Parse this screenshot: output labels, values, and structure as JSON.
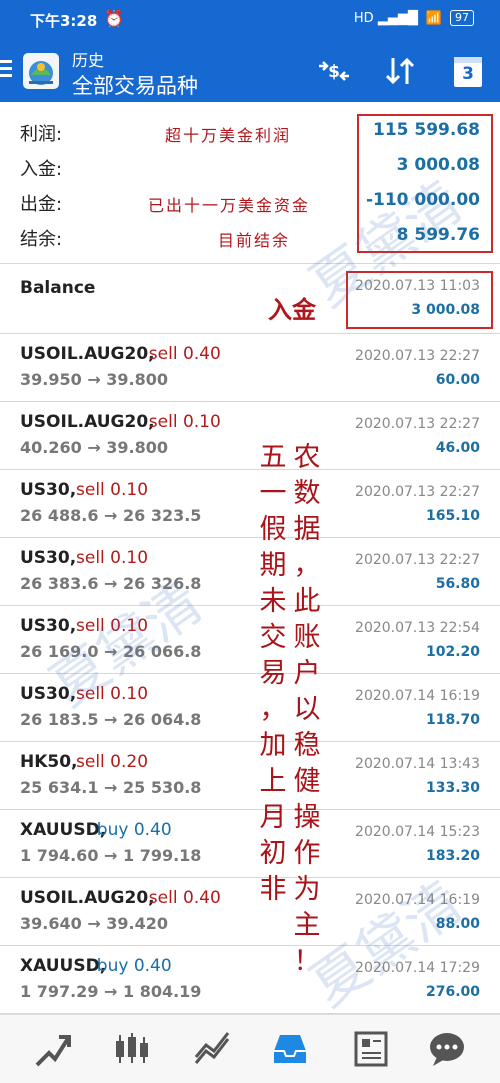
{
  "status_bar": {
    "time": "下午3:28",
    "signal": "HD",
    "battery": "97"
  },
  "app_bar": {
    "subtitle": "历史",
    "title": "全部交易品种",
    "calendar_day": "3",
    "icons": [
      "menu-icon",
      "app-logo",
      "currency-swap-icon",
      "sort-icon",
      "calendar-icon"
    ]
  },
  "summary": {
    "rows": [
      {
        "label": "利润:",
        "value": "115 599.68",
        "note": "超十万美金利润"
      },
      {
        "label": "入金:",
        "value": "3 000.08",
        "note": ""
      },
      {
        "label": "出金:",
        "value": "-110 000.00",
        "note": "已出十一万美金资金"
      },
      {
        "label": "结余:",
        "value": "8 599.76",
        "note": "目前结余"
      }
    ]
  },
  "balance": {
    "label": "Balance",
    "date": "2020.07.13 11:03",
    "amount": "3 000.08",
    "note": "入金"
  },
  "trades": [
    {
      "symbol": "USOIL.AUG20,",
      "side": "sell 0.40",
      "prices": "39.950 → 39.800",
      "date": "2020.07.13 22:27",
      "profit": "60.00"
    },
    {
      "symbol": "USOIL.AUG20,",
      "side": "sell 0.10",
      "prices": "40.260 → 39.800",
      "date": "2020.07.13 22:27",
      "profit": "46.00"
    },
    {
      "symbol": "US30,",
      "side": "sell 0.10",
      "prices": "26 488.6 → 26 323.5",
      "date": "2020.07.13 22:27",
      "profit": "165.10"
    },
    {
      "symbol": "US30,",
      "side": "sell 0.10",
      "prices": "26 383.6 → 26 326.8",
      "date": "2020.07.13 22:27",
      "profit": "56.80"
    },
    {
      "symbol": "US30,",
      "side": "sell 0.10",
      "prices": "26 169.0 → 26 066.8",
      "date": "2020.07.13 22:54",
      "profit": "102.20"
    },
    {
      "symbol": "US30,",
      "side": "sell 0.10",
      "prices": "26 183.5 → 26 064.8",
      "date": "2020.07.14 16:19",
      "profit": "118.70"
    },
    {
      "symbol": "HK50,",
      "side": "sell 0.20",
      "prices": "25 634.1 → 25 530.8",
      "date": "2020.07.14 13:43",
      "profit": "133.30"
    },
    {
      "symbol": "XAUUSD,",
      "side": "buy 0.40",
      "prices": "1 794.60 → 1 799.18",
      "date": "2020.07.14 15:23",
      "profit": "183.20"
    },
    {
      "symbol": "USOIL.AUG20,",
      "side": "sell 0.40",
      "prices": "39.640 → 39.420",
      "date": "2020.07.14 16:19",
      "profit": "88.00"
    },
    {
      "symbol": "XAUUSD,",
      "side": "buy 0.40",
      "prices": "1 797.29 → 1 804.19",
      "date": "2020.07.14 17:29",
      "profit": "276.00"
    }
  ],
  "annotation_columns": [
    [
      "农",
      "数",
      "据",
      "，",
      "此",
      "账",
      "户",
      "以",
      "稳",
      "健",
      "操",
      "作",
      "为",
      "主",
      "！"
    ],
    [
      "五",
      "一",
      "假",
      "期",
      "未",
      "交",
      "易",
      "，",
      "加",
      "上",
      "月",
      "初",
      "非"
    ]
  ],
  "watermark": "夏黛清",
  "bottom_nav": [
    "trade-chart-icon",
    "candlestick-icon",
    "line-chart-icon",
    "history-inbox-icon",
    "news-icon",
    "chat-icon"
  ],
  "colors": {
    "app_bar": "#1769d2",
    "profit_blue": "#1c6fa3",
    "sell_red": "#b31b1b",
    "annotation_red": "#a8141a",
    "active_nav": "#1e88e5"
  }
}
